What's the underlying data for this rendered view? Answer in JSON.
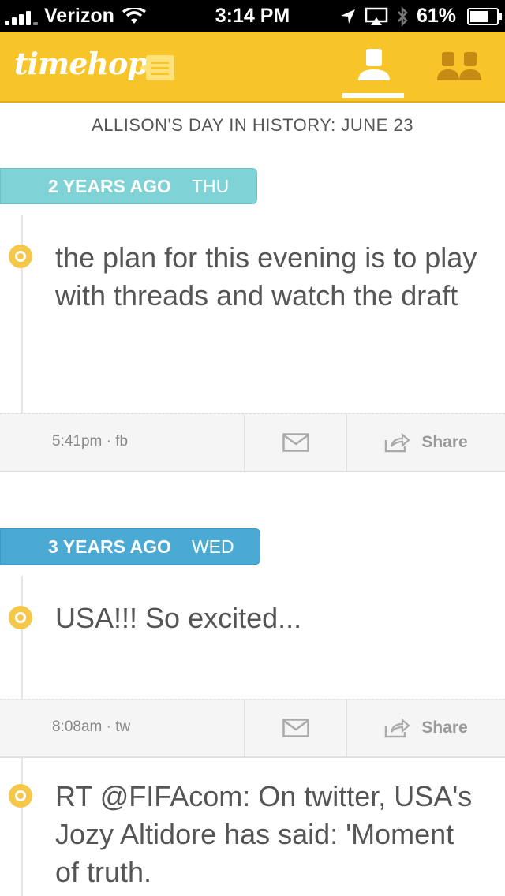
{
  "status_bar": {
    "carrier": "Verizon",
    "time": "3:14 PM",
    "battery": "61%"
  },
  "header": {
    "logo": "timehop"
  },
  "page_title": "ALLISON'S DAY IN HISTORY: JUNE 23",
  "entries": [
    {
      "years_ago": "2 YEARS AGO",
      "weekday": "THU",
      "text": "the plan for this evening is to play with threads and watch the draft",
      "meta": "5:41pm · fb",
      "share_label": "Share"
    },
    {
      "years_ago": "3 YEARS AGO",
      "weekday": "WED",
      "text": "USA!!! So excited...",
      "meta": "8:08am · tw",
      "share_label": "Share"
    }
  ],
  "partial_entry": {
    "text": "RT @FIFAcom: On twitter, USA's Jozy Altidore has said: 'Moment of truth."
  },
  "colors": {
    "header": "#f7c52a",
    "tag_2_years": "#7fd3d6",
    "tag_3_years": "#4aaad4",
    "dot": "#f6c84a"
  }
}
